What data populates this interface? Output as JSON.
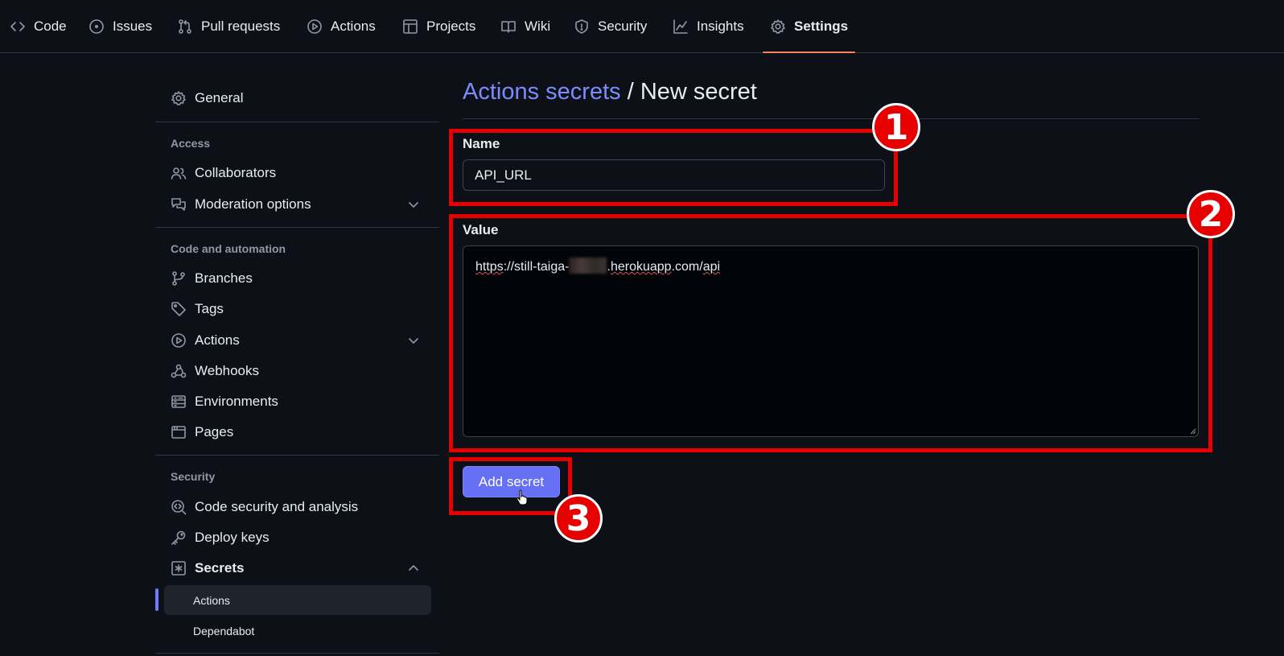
{
  "topnav": {
    "tabs": [
      {
        "label": "Code",
        "icon": "code-icon"
      },
      {
        "label": "Issues",
        "icon": "issue-icon"
      },
      {
        "label": "Pull requests",
        "icon": "pull-request-icon"
      },
      {
        "label": "Actions",
        "icon": "play-icon"
      },
      {
        "label": "Projects",
        "icon": "table-icon"
      },
      {
        "label": "Wiki",
        "icon": "book-icon"
      },
      {
        "label": "Security",
        "icon": "shield-icon"
      },
      {
        "label": "Insights",
        "icon": "graph-icon"
      },
      {
        "label": "Settings",
        "icon": "gear-icon",
        "active": true
      }
    ]
  },
  "sidebar": {
    "general": "General",
    "access_heading": "Access",
    "collaborators": "Collaborators",
    "moderation": "Moderation options",
    "code_heading": "Code and automation",
    "branches": "Branches",
    "tags": "Tags",
    "actions": "Actions",
    "webhooks": "Webhooks",
    "environments": "Environments",
    "pages": "Pages",
    "security_heading": "Security",
    "code_security": "Code security and analysis",
    "deploy_keys": "Deploy keys",
    "secrets": "Secrets",
    "secrets_actions": "Actions",
    "secrets_dependabot": "Dependabot"
  },
  "main": {
    "breadcrumb_link": "Actions secrets",
    "breadcrumb_sep": " / ",
    "breadcrumb_current": "New secret",
    "name_label": "Name",
    "name_value": "API_URL",
    "value_label": "Value",
    "value_parts": {
      "p1": "https",
      "p2": "://still-taiga-",
      "p3": ".",
      "p4": "herokuapp",
      "p5": ".com/",
      "p6": "api"
    },
    "submit_label": "Add secret"
  },
  "annotations": {
    "badge1": "1",
    "badge2": "2",
    "badge3": "3",
    "color": "#e60000"
  },
  "colors": {
    "accent_link": "#7c8cff",
    "button": "#6670f5",
    "active_underline": "#f78166",
    "background": "#0d1117"
  }
}
